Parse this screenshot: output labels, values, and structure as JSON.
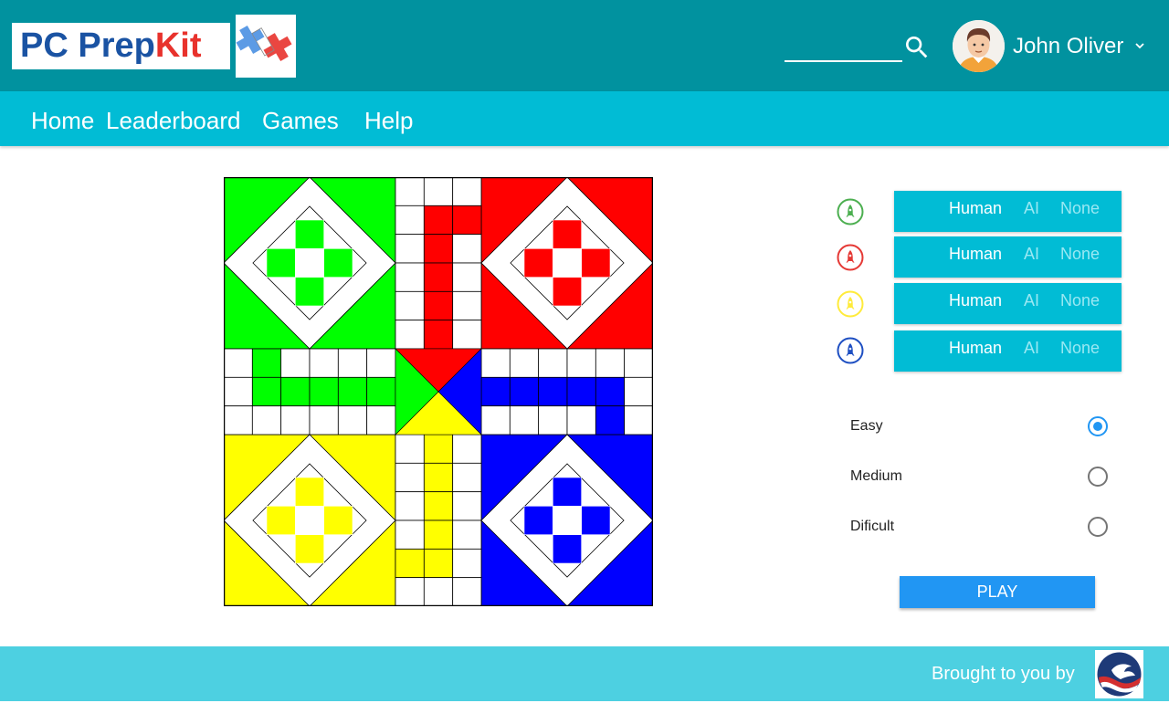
{
  "header": {
    "logo": {
      "pc": "PC",
      "prep": "Prep",
      "kit": "Kit"
    },
    "search": {
      "value": "",
      "placeholder": ""
    },
    "user": {
      "name": "John Oliver"
    }
  },
  "nav": {
    "items": [
      "Home",
      "Leaderboard",
      "Games",
      "Help"
    ]
  },
  "board": {
    "colors": {
      "green": "#00ff00",
      "red": "#ff0000",
      "blue": "#0000ff",
      "yellow": "#ffff00"
    }
  },
  "players": [
    {
      "color": "#4caf50",
      "icon": "rocket-icon",
      "options": [
        "Human",
        "AI",
        "None"
      ],
      "selected": "Human"
    },
    {
      "color": "#e53935",
      "icon": "rocket-icon",
      "options": [
        "Human",
        "AI",
        "None"
      ],
      "selected": "Human"
    },
    {
      "color": "#ffeb3b",
      "icon": "rocket-icon",
      "options": [
        "Human",
        "AI",
        "None"
      ],
      "selected": "Human"
    },
    {
      "color": "#1e4fc2",
      "icon": "rocket-icon",
      "options": [
        "Human",
        "AI",
        "None"
      ],
      "selected": "Human"
    }
  ],
  "difficulty": {
    "options": [
      "Easy",
      "Medium",
      "Dificult"
    ],
    "selected": "Easy"
  },
  "play_label": "PLAY",
  "footer": {
    "brought_by": "Brought to you by"
  },
  "theme": {
    "header_bg": "#01929f",
    "nav_bg": "#01bcd5",
    "footer_bg": "#4dd0e1",
    "accent": "#2196f3"
  }
}
